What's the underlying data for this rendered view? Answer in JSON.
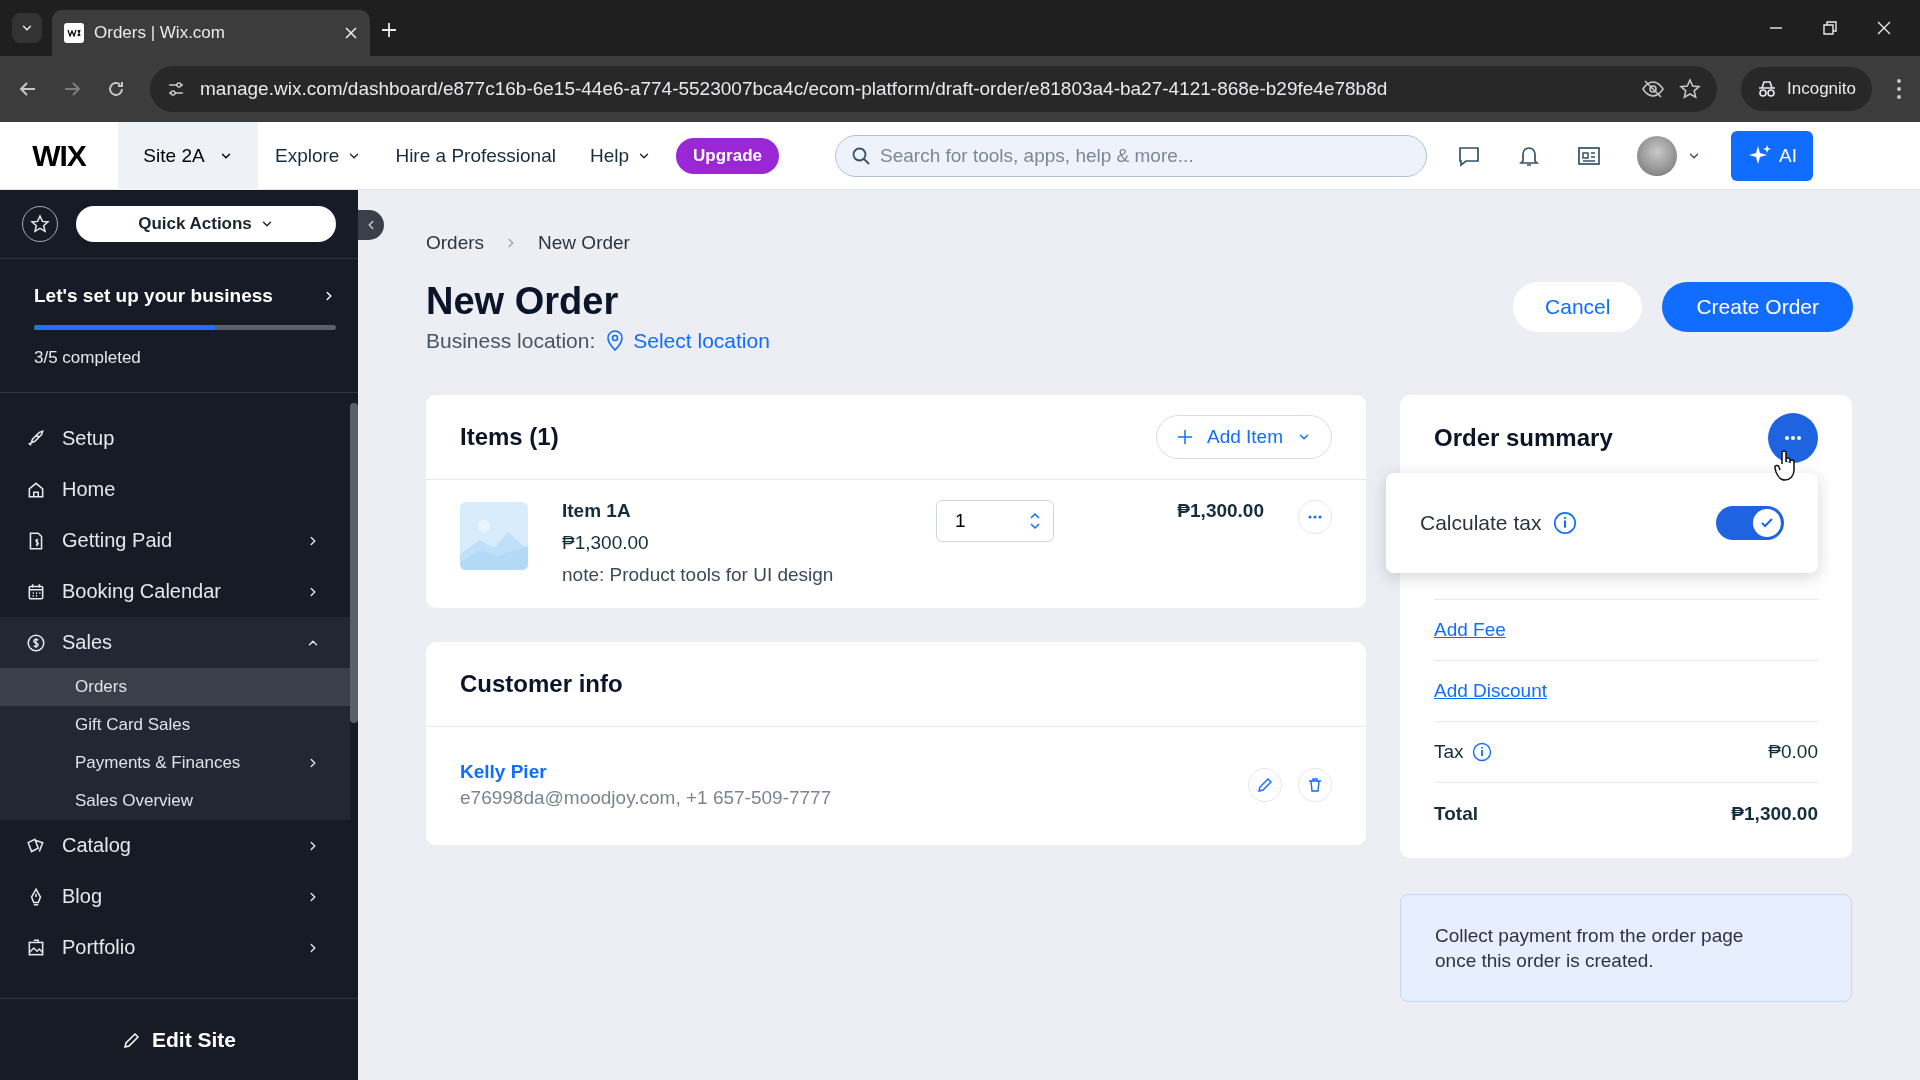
{
  "browser": {
    "tab_title": "Orders | Wix.com",
    "url": "manage.wix.com/dashboard/e877c16b-6e15-44e6-a774-5523007bca4c/ecom-platform/draft-order/e81803a4-ba27-4121-868e-b29fe4e78b8d",
    "profile_label": "Incognito"
  },
  "topbar": {
    "logo": "WIX",
    "site": "Site 2A",
    "menus": [
      {
        "label": "Explore",
        "dropdown": true
      },
      {
        "label": "Hire a Professional",
        "dropdown": false
      },
      {
        "label": "Help",
        "dropdown": true
      }
    ],
    "upgrade": "Upgrade",
    "search": {
      "placeholder": "Search for tools, apps, help & more..."
    },
    "ai_label": "AI"
  },
  "sidebar": {
    "quick_actions": "Quick Actions",
    "setup": {
      "title": "Let's set up your business",
      "level": 0.6,
      "progress": "3/5 completed"
    },
    "items": [
      {
        "label": "Setup",
        "expandable": false,
        "expanded": false
      },
      {
        "label": "Home",
        "expandable": false,
        "expanded": false
      },
      {
        "label": "Getting Paid",
        "expandable": true,
        "expanded": false
      },
      {
        "label": "Booking Calendar",
        "expandable": true,
        "expanded": false
      },
      {
        "label": "Sales",
        "expandable": true,
        "expanded": true,
        "children": [
          {
            "label": "Orders",
            "selected": true,
            "expandable": false
          },
          {
            "label": "Gift Card Sales",
            "selected": false,
            "expandable": false
          },
          {
            "label": "Payments & Finances",
            "selected": false,
            "expandable": true
          },
          {
            "label": "Sales Overview",
            "selected": false,
            "expandable": false
          }
        ]
      },
      {
        "label": "Catalog",
        "expandable": true,
        "expanded": false
      },
      {
        "label": "Blog",
        "expandable": true,
        "expanded": false
      },
      {
        "label": "Portfolio",
        "expandable": true,
        "expanded": false
      }
    ],
    "edit_site": "Edit Site"
  },
  "breadcrumbs": [
    "Orders",
    "New Order"
  ],
  "page": {
    "title": "New Order",
    "location_label": "Business location:",
    "location_link": "Select location",
    "cancel": "Cancel",
    "create": "Create Order"
  },
  "items_card": {
    "title": "Items (1)",
    "add_item": "Add Item",
    "rows": [
      {
        "name": "Item 1A",
        "price": "₱1,300.00",
        "note": "note: Product tools for UI design",
        "quantity": "1",
        "total": "₱1,300.00"
      }
    ]
  },
  "customer_card": {
    "title": "Customer info",
    "name": "Kelly Pier",
    "contact": "e76998da@moodjoy.com, +1 657-509-7777"
  },
  "summary": {
    "title": "Order summary",
    "popup": {
      "label": "Calculate tax",
      "on": true
    },
    "links": [
      "Add Fee",
      "Add Discount"
    ],
    "tax": {
      "label": "Tax",
      "value": "₱0.00"
    },
    "total": {
      "label": "Total",
      "value": "₱1,300.00"
    }
  },
  "notice": "Collect payment from the order page once this order is created."
}
